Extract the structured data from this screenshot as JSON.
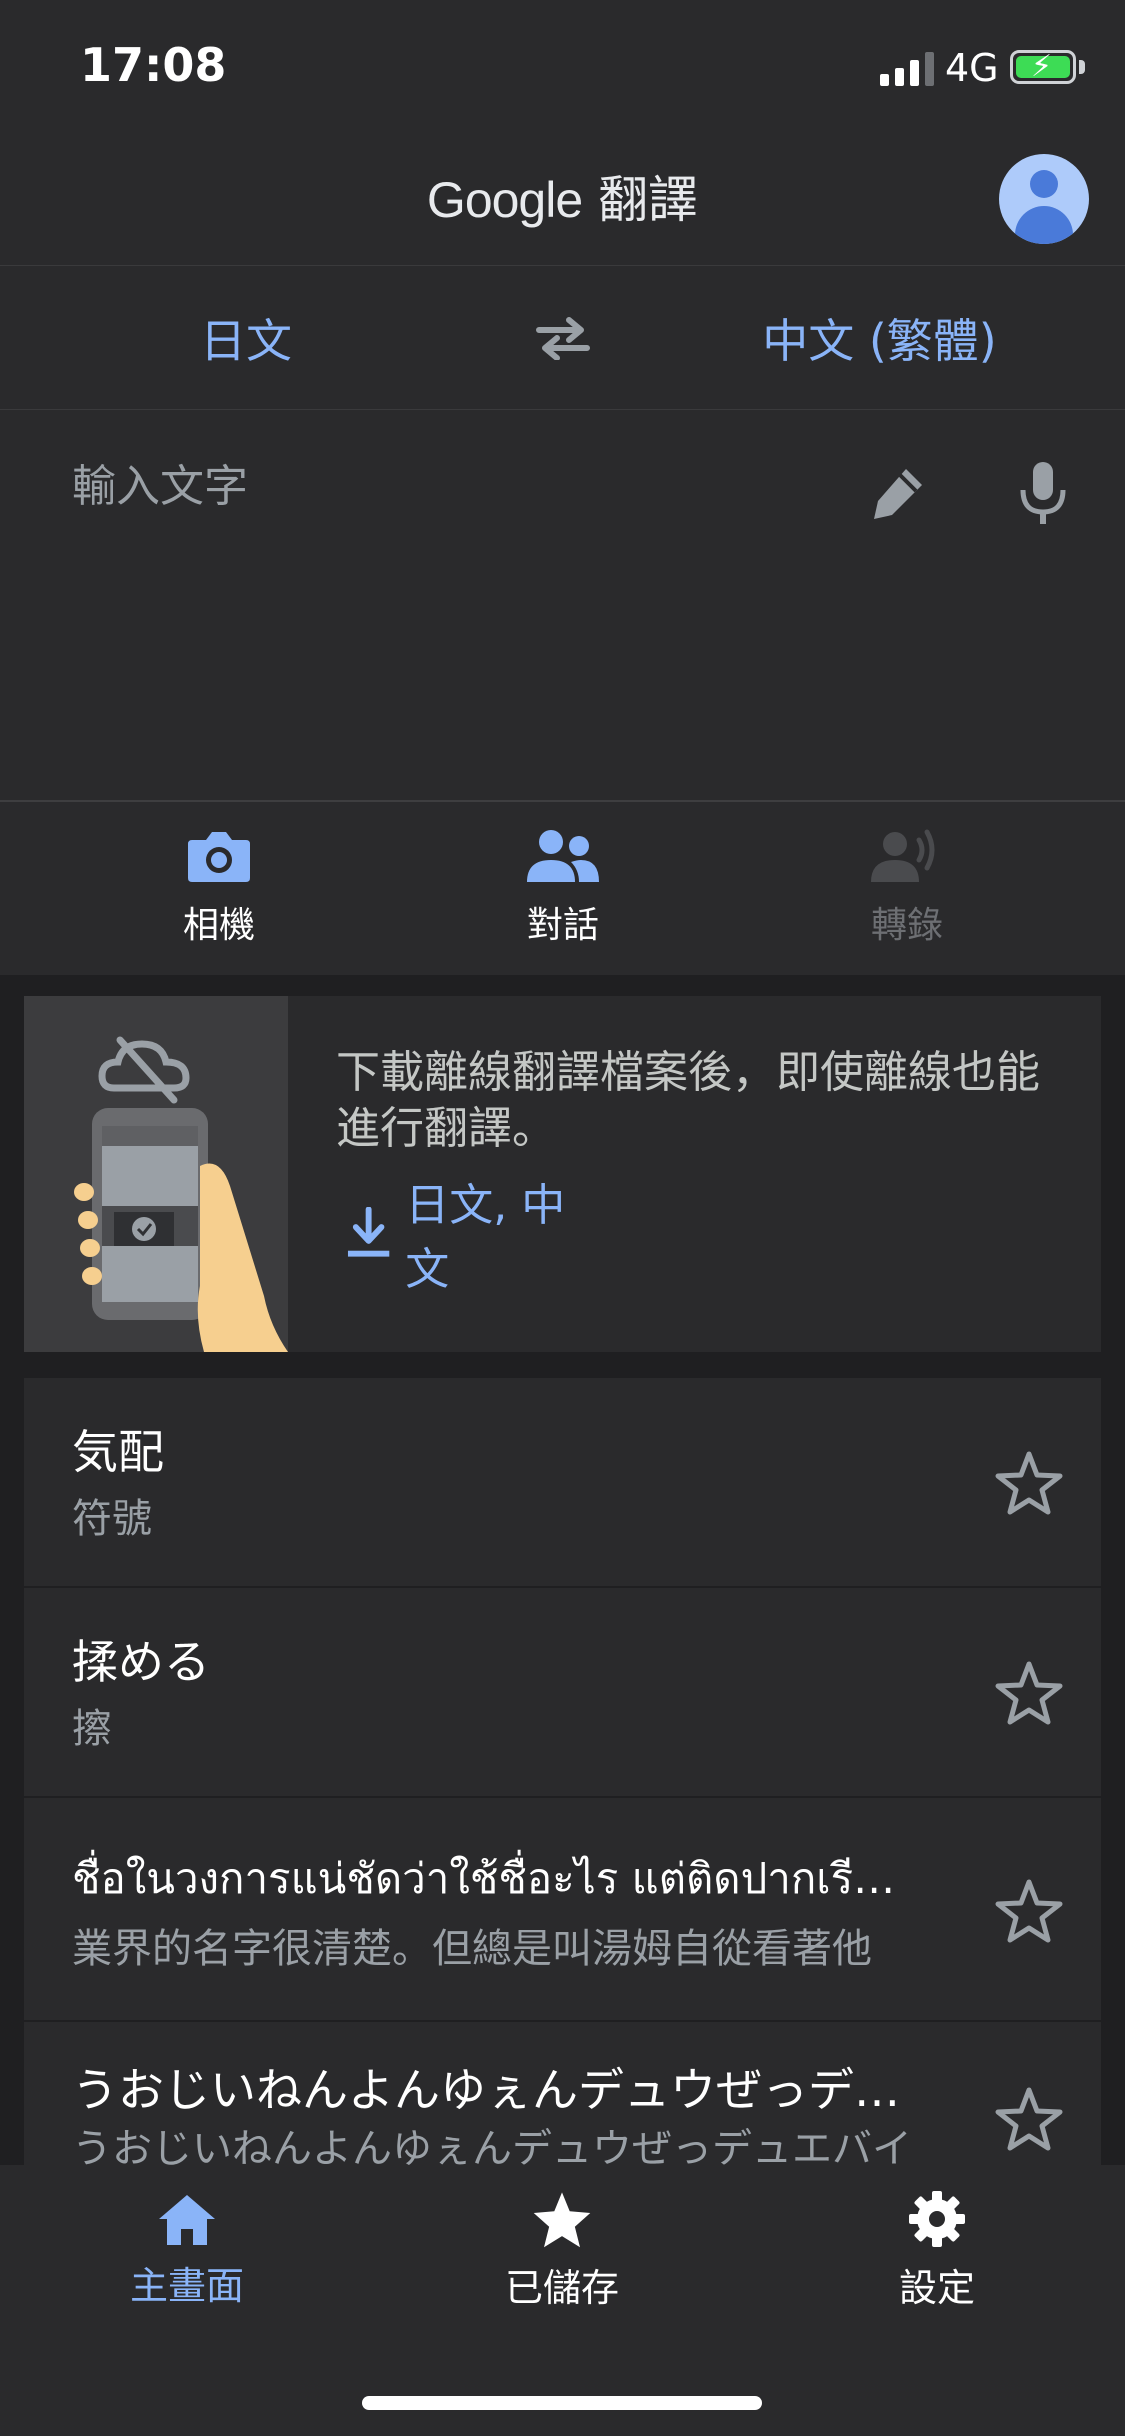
{
  "status_bar": {
    "time": "17:08",
    "network": "4G"
  },
  "header": {
    "logo_brand": "Google",
    "logo_product": "翻譯"
  },
  "language_bar": {
    "source": "日文",
    "target": "中文 (繁體)"
  },
  "input": {
    "placeholder": "輸入文字"
  },
  "modes": [
    {
      "label": "相機"
    },
    {
      "label": "對話"
    },
    {
      "label": "轉錄"
    }
  ],
  "promo": {
    "text": "下載離線翻譯檔案後，即使離線也能進行翻譯。",
    "download_label": "日文, 中文"
  },
  "history": [
    {
      "source": "気配",
      "translation": "符號"
    },
    {
      "source": "揉める",
      "translation": "擦"
    },
    {
      "source": "ชื่อในวงการแน่ชัดว่าใช้ชื่อะไร แต่ติดปากเรี…",
      "translation": "業界的名字很清楚。但總是叫湯姆自從看著他"
    },
    {
      "source": "うおじいねんよんゆぇんデュウぜっデ…",
      "translation": "うおじいねんよんゆぇんデュウぜっデュエバイ"
    }
  ],
  "bottom_nav": [
    {
      "label": "主畫面",
      "active": true
    },
    {
      "label": "已儲存",
      "active": false
    },
    {
      "label": "設定",
      "active": false
    }
  ],
  "colors": {
    "accent": "#8ab4f8",
    "surface": "#2a2a2c",
    "background": "#1f1f21"
  }
}
